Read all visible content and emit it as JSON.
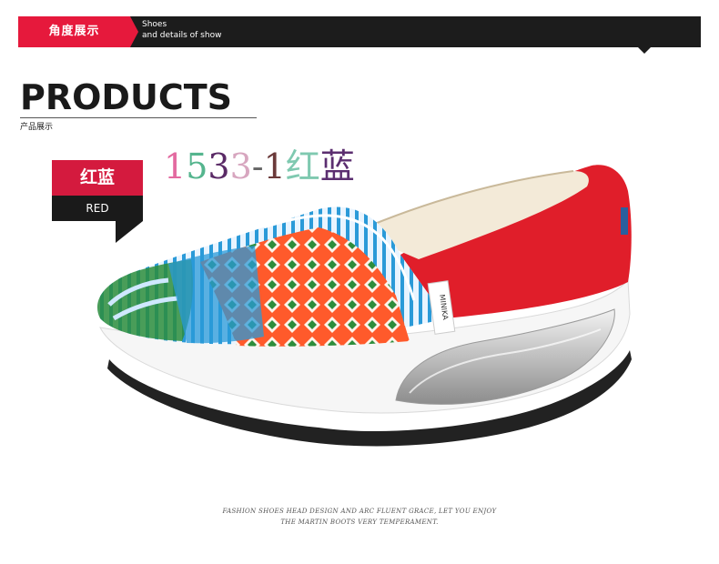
{
  "banner": {
    "tag_label": "角度展示",
    "subtitle_line1": "Shoes",
    "subtitle_line2": "and details of show"
  },
  "products": {
    "heading": "PRODUCTS",
    "subheading": "产品展示"
  },
  "color_tag": {
    "name_cn": "红蓝",
    "name_en": "RED",
    "main_color": "#d41a3e"
  },
  "model_code": {
    "chars": [
      {
        "c": "1",
        "color": "#e36aa0"
      },
      {
        "c": "5",
        "color": "#55b58e"
      },
      {
        "c": "3",
        "color": "#5a2a66"
      },
      {
        "c": "3",
        "color": "#d7a6bf"
      },
      {
        "c": "-",
        "color": "#666666"
      },
      {
        "c": "1",
        "color": "#6b3a3a"
      },
      {
        "c": "红",
        "color": "#7fc9b0"
      },
      {
        "c": "蓝",
        "color": "#5b2e70"
      }
    ]
  },
  "product_image": {
    "brand_label": "MINIKA",
    "colors": {
      "upper_red": "#e01e2a",
      "sole": "#f4f4f4",
      "outsole": "#222222",
      "pattern_blue": "#2a9ad8",
      "pattern_green": "#2d8d3c",
      "pattern_orange": "#ff5a2b"
    }
  },
  "caption": {
    "line1": "FASHION SHOES HEAD DESIGN AND ARC FLUENT GRACE, LET YOU ENJOY",
    "line2": "THE MARTIN BOOTS VERY TEMPERAMENT."
  }
}
